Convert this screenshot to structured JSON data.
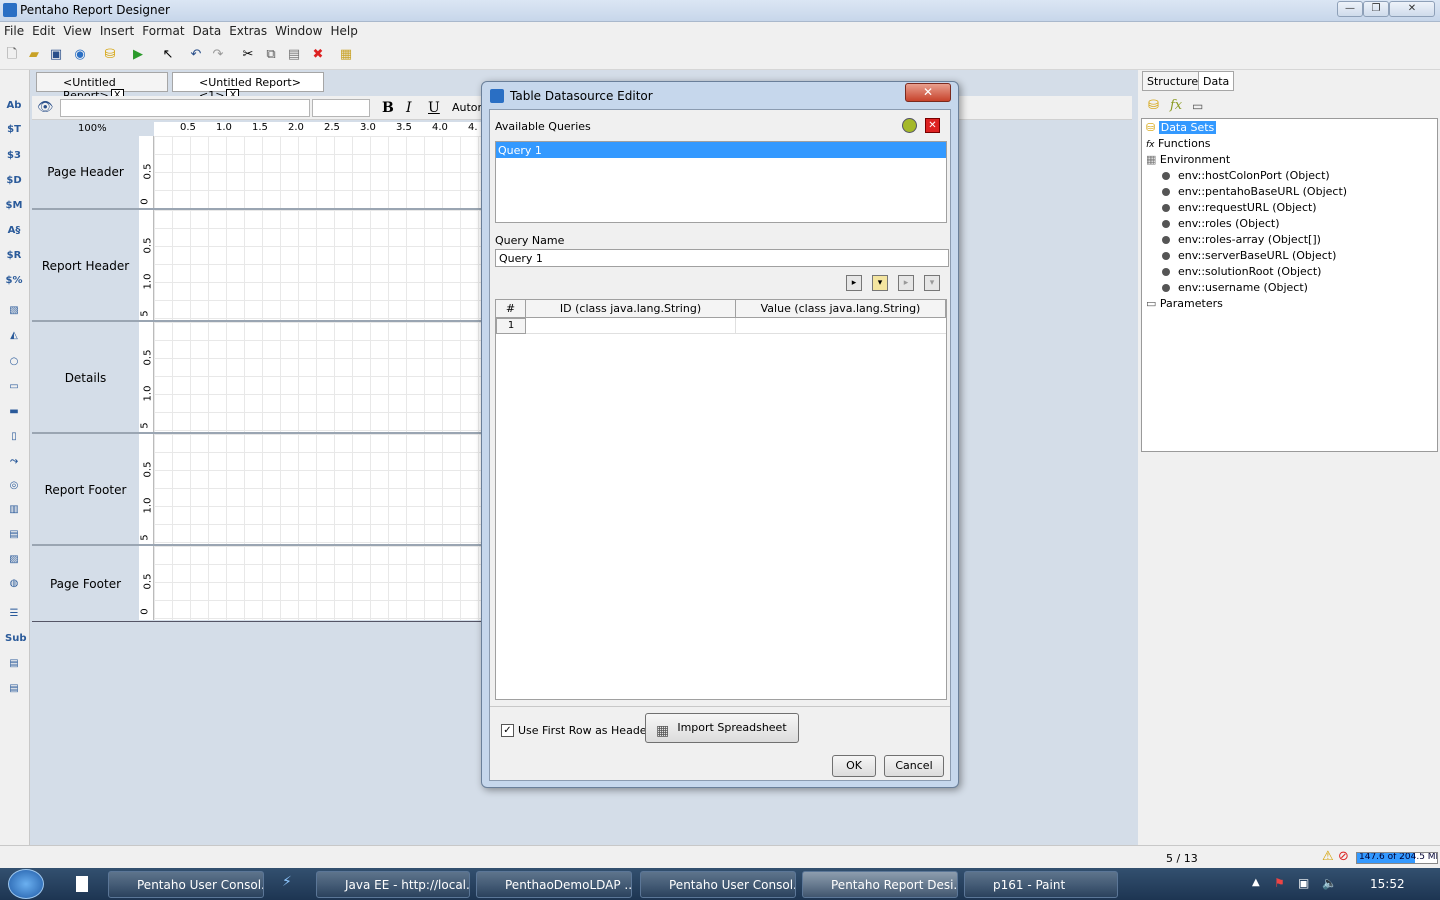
{
  "window": {
    "title": "Pentaho Report Designer"
  },
  "menu": [
    "File",
    "Edit",
    "View",
    "Insert",
    "Format",
    "Data",
    "Extras",
    "Window",
    "Help"
  ],
  "tabs": [
    {
      "label": "<Untitled Report>",
      "close": "X"
    },
    {
      "label": "<Untitled Report><1>",
      "close": "X"
    }
  ],
  "format": {
    "bold": "B",
    "italic": "I",
    "underline": "U",
    "auto": "Autor"
  },
  "zoom": "100%",
  "ruler_ticks": [
    "0.5",
    "1.0",
    "1.5",
    "2.0",
    "2.5",
    "3.0",
    "3.5",
    "4.0",
    "4."
  ],
  "sections": [
    "Page Header",
    "Report Header",
    "Details",
    "Report Footer",
    "Page Footer"
  ],
  "vruler": {
    "a": "0.5",
    "b": "1.0",
    "c": "5",
    "z": "0"
  },
  "right_tabs": [
    "Structure",
    "Data"
  ],
  "tree": {
    "data_sets": "Data Sets",
    "functions": "Functions",
    "environment": "Environment",
    "env_items": [
      "env::hostColonPort (Object)",
      "env::pentahoBaseURL (Object)",
      "env::requestURL (Object)",
      "env::roles (Object)",
      "env::roles-array (Object[])",
      "env::serverBaseURL (Object)",
      "env::solutionRoot (Object)",
      "env::username (Object)"
    ],
    "parameters": "Parameters"
  },
  "dialog": {
    "title": "Table Datasource Editor",
    "available_queries_label": "Available Queries",
    "queries": [
      "Query 1"
    ],
    "query_name_label": "Query Name",
    "query_name_value": "Query 1",
    "columns": [
      "#",
      "ID (class java.lang.String)",
      "Value (class java.lang.String)"
    ],
    "rows": [
      "1"
    ],
    "use_first_row_label": "Use First Row as Header",
    "import_label": "Import Spreadsheet",
    "ok_label": "OK",
    "cancel_label": "Cancel"
  },
  "status": {
    "page": "5 / 13",
    "memory": "147.6 of 204.5 MB"
  },
  "taskbar": {
    "items": [
      "Pentaho User Consol...",
      "Java EE - http://local...",
      "PenthaoDemoLDAP ...",
      "Pentaho User Consol...",
      "Pentaho Report Desi...",
      "p161 - Paint"
    ],
    "clock": "15:52"
  }
}
